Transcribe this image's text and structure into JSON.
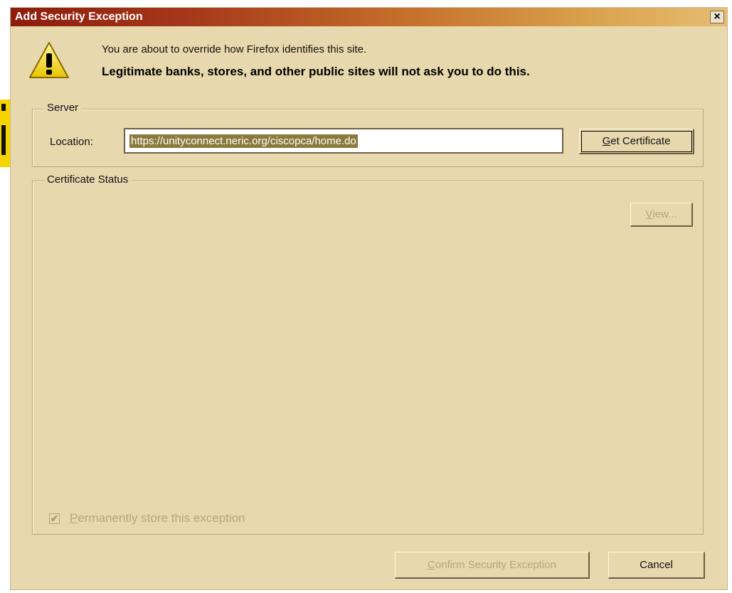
{
  "window": {
    "title": "Add Security Exception",
    "close_label": "×"
  },
  "message": {
    "line1": "You are about to override how Firefox identifies this site.",
    "line2": "Legitimate banks, stores, and other public sites will not ask you to do this."
  },
  "server": {
    "legend": "Server",
    "location_label": "Location:",
    "location_value": "https://unityconnect.neric.org/ciscopca/home.do",
    "get_certificate": {
      "accesskey": "G",
      "rest": "et Certificate"
    }
  },
  "certificate_status": {
    "legend": "Certificate Status",
    "view": {
      "accesskey": "V",
      "rest": "iew..."
    },
    "permanent": {
      "accesskey": "P",
      "rest": "ermanently store this exception",
      "checked": true
    }
  },
  "buttons": {
    "confirm": {
      "accesskey": "C",
      "rest": "onfirm Security Exception"
    },
    "cancel": "Cancel"
  },
  "colors": {
    "dialog_bg": "#e8d8ae",
    "title_start": "#8d1c0d",
    "title_end": "#e6bd72",
    "selection": "#8a7a3c",
    "disabled_text": "#b8a677"
  }
}
